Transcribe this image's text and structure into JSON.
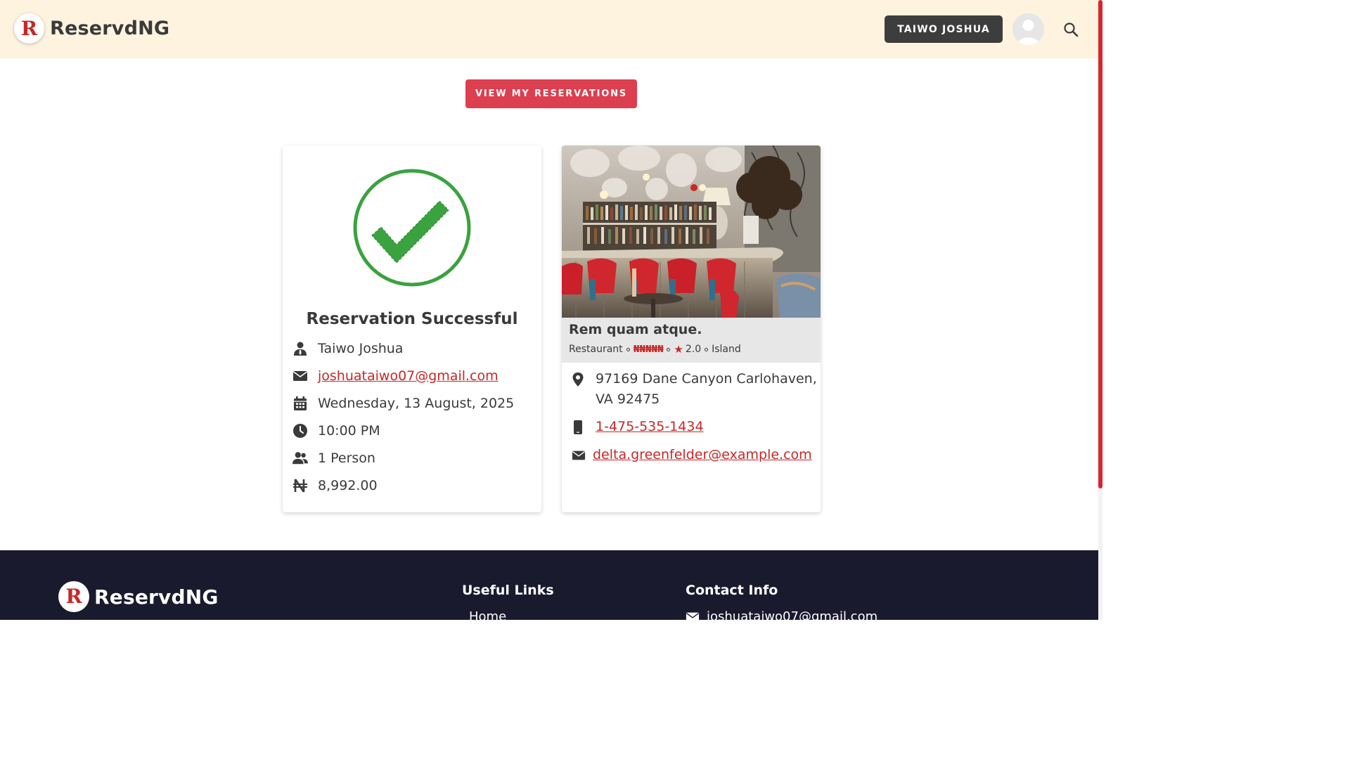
{
  "header": {
    "brand_letter": "R",
    "brand_name": "ReservdNG",
    "user_button": "TAIWO JOSHUA"
  },
  "actions": {
    "view_reservations": "VIEW MY RESERVATIONS"
  },
  "reservation": {
    "title": "Reservation Successful",
    "name": "Taiwo Joshua",
    "email": "joshuataiwo07@gmail.com",
    "date": "Wednesday, 13 August, 2025",
    "time": "10:00 PM",
    "guests": "1 Person",
    "amount": "8,992.00"
  },
  "restaurant": {
    "name": "Rem quam atque.",
    "type": "Restaurant",
    "price_level": "₦₦₦₦₦",
    "rating": "2.0",
    "area": "Island",
    "address": "97169 Dane Canyon Carlohaven, VA 92475",
    "phone": "1-475-535-1434",
    "email": "delta.greenfelder@example.com"
  },
  "footer": {
    "brand_name": "ReservdNG",
    "useful_links_heading": "Useful Links",
    "home_link": "Home",
    "contact_heading": "Contact Info",
    "contact_email": "joshuataiwo07@gmail.com"
  },
  "colors": {
    "brand_red": "#c62828",
    "button_red": "#dc3f4f",
    "header_bg": "#fdf3df",
    "footer_bg": "#1a1a2e",
    "success_green": "#3aa23f"
  }
}
